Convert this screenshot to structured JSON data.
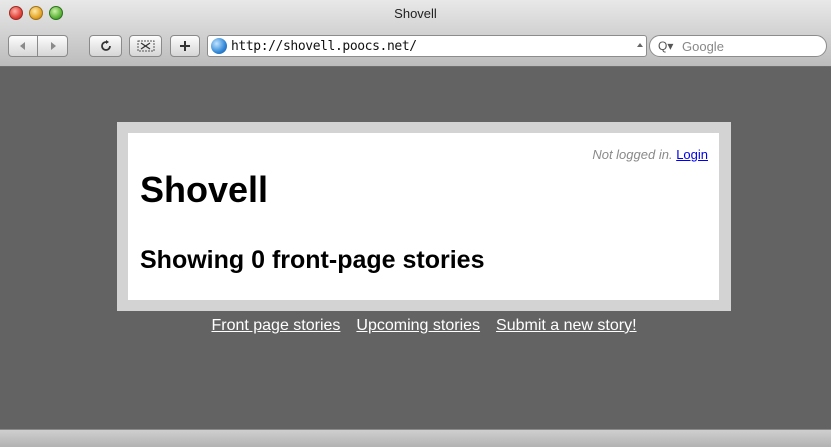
{
  "window": {
    "title": "Shovell"
  },
  "toolbar": {
    "back_icon": "back-arrow-icon",
    "forward_icon": "forward-arrow-icon",
    "reload_icon": "reload-icon",
    "snippet_icon": "snippet-icon",
    "add_icon": "plus-icon",
    "url": "http://shovell.poocs.net/",
    "search_placeholder": "Google"
  },
  "page": {
    "login_status": "Not logged in.",
    "login_link": "Login",
    "site_title": "Shovell",
    "stories_heading": "Showing 0 front-page stories"
  },
  "footer_nav": [
    {
      "label": "Front page stories"
    },
    {
      "label": "Upcoming stories"
    },
    {
      "label": "Submit a new story!"
    }
  ],
  "colors": {
    "background": "#636363",
    "content_frame": "#d3d3d3",
    "link": "#0000ee"
  }
}
